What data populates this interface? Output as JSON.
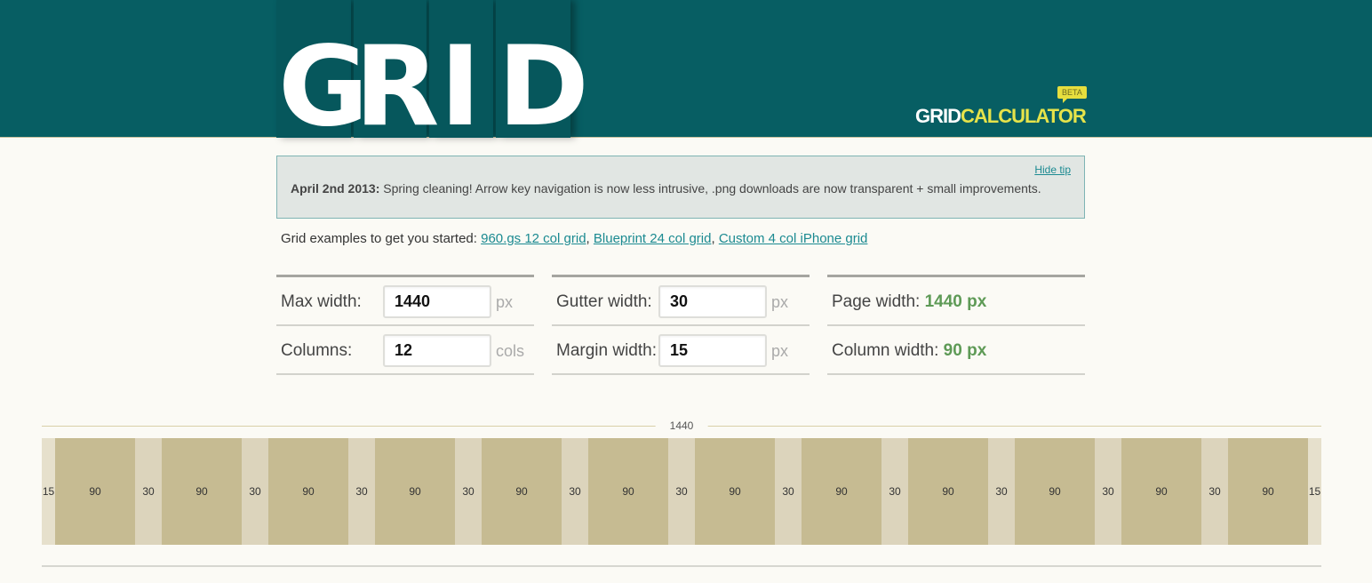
{
  "header": {
    "logo_letters": [
      "G",
      "R",
      "I",
      "D"
    ],
    "brand_part1": "GRID",
    "brand_part2": "CALCULATOR",
    "beta_badge": "BETA",
    "colors": {
      "background": "#075e63",
      "brand_accent": "#e6e34a"
    }
  },
  "tip": {
    "hide_label": "Hide tip",
    "date": "April 2nd 2013:",
    "message": " Spring cleaning! Arrow key navigation is now less intrusive, .png downloads are now transparent + small improvements."
  },
  "examples": {
    "intro": "Grid examples to get you started: ",
    "links": [
      "960.gs 12 col grid",
      "Blueprint 24 col grid",
      "Custom 4 col iPhone grid"
    ],
    "separator": ", "
  },
  "form": {
    "max_width": {
      "label": "Max width:",
      "value": "1440",
      "unit": "px"
    },
    "columns": {
      "label": "Columns:",
      "value": "12",
      "unit": "cols"
    },
    "gutter_width": {
      "label": "Gutter width:",
      "value": "30",
      "unit": "px"
    },
    "margin_width": {
      "label": "Margin width:",
      "value": "15",
      "unit": "px"
    },
    "page_width": {
      "label": "Page width:",
      "value": "1440 px"
    },
    "column_width": {
      "label": "Column width:",
      "value": "90 px"
    }
  },
  "preview": {
    "total_width": "1440",
    "columns": 12,
    "column_width": 90,
    "gutter_width": 30,
    "margin_width": 15
  }
}
